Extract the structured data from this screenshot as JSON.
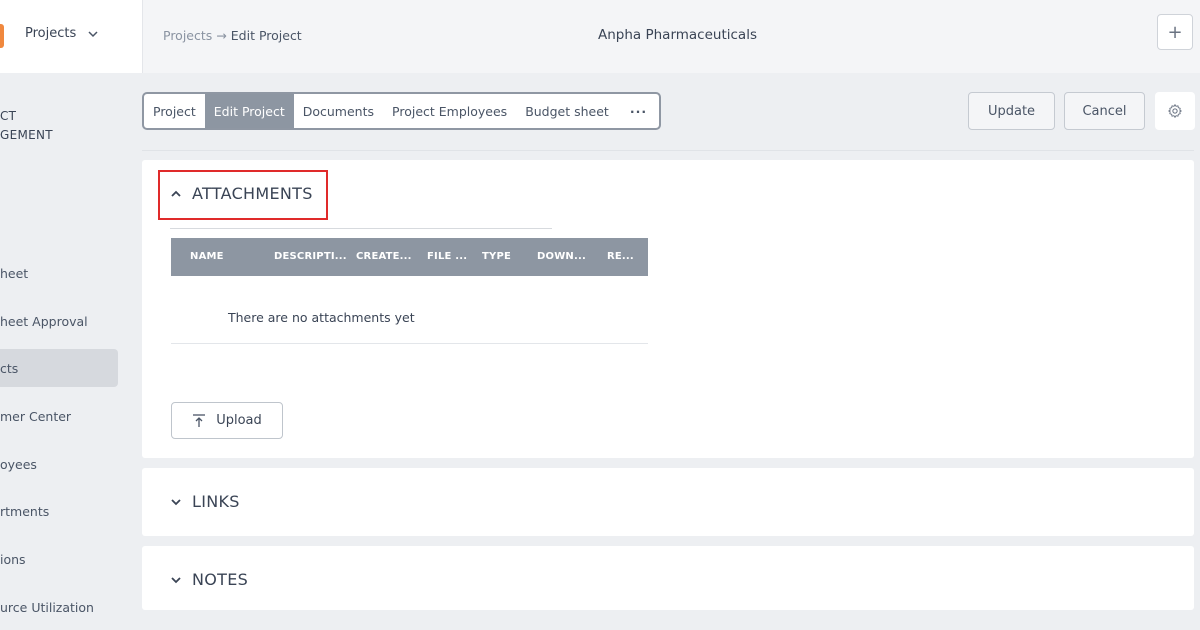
{
  "sidebar": {
    "app_name": "Projects",
    "module_title_line1": "CT",
    "module_title_line2": "GEMENT",
    "items": [
      {
        "label": "heet"
      },
      {
        "label": "heet Approval"
      },
      {
        "label": "cts"
      },
      {
        "label": "mer Center"
      },
      {
        "label": "oyees"
      },
      {
        "label": "rtments"
      },
      {
        "label": "ions"
      },
      {
        "label": "urce Utilization"
      }
    ]
  },
  "header": {
    "breadcrumb_parent": "Projects",
    "breadcrumb_arrow": "→",
    "breadcrumb_current": "Edit Project",
    "company": "Anpha Pharmaceuticals",
    "plus": "+"
  },
  "toolbar": {
    "tabs": [
      {
        "label": "Project"
      },
      {
        "label": "Edit Project"
      },
      {
        "label": "Documents"
      },
      {
        "label": "Project Employees"
      },
      {
        "label": "Budget sheet"
      },
      {
        "label": "···"
      }
    ],
    "update_label": "Update",
    "cancel_label": "Cancel"
  },
  "attachments": {
    "title": "ATTACHMENTS",
    "columns": [
      "NAME",
      "DESCRIPTI...",
      "CREATE...",
      "FILE ...",
      "TYPE",
      "DOWN...",
      "RE..."
    ],
    "empty_message": "There are no attachments yet",
    "upload_label": "Upload"
  },
  "links": {
    "title": "LINKS"
  },
  "notes": {
    "title": "NOTES"
  },
  "colors": {
    "accent_gray": "#8d96a2",
    "highlight_red": "#e02a2a",
    "logo_orange": "#f0883e"
  }
}
